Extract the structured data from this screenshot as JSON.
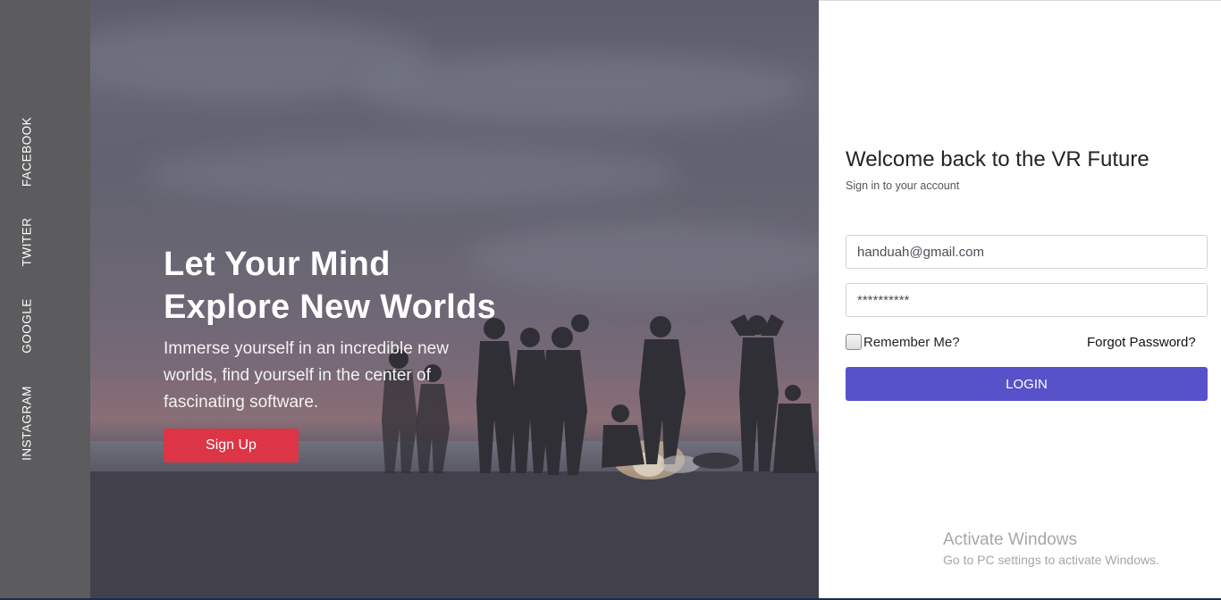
{
  "social": {
    "facebook": "FACEBOOK",
    "twitter": "TWITER",
    "google": "GOOGLE",
    "instagram": "INSTAGRAM"
  },
  "hero": {
    "title_line1": "Let Your Mind",
    "title_line2": "Explore New Worlds",
    "subtitle_line1": "Immerse yourself in an incredible new",
    "subtitle_line2": "worlds, find yourself in the center of",
    "subtitle_line3": "fascinating software.",
    "signup_label": "Sign Up",
    "background_image": "people-around-campfire-on-beach"
  },
  "login": {
    "title": "Welcome back to the VR Future",
    "subtitle": "Sign in to your account",
    "email_value": "handuah@gmail.com",
    "password_value": "**********",
    "remember_label": "Remember Me?",
    "remember_checked": false,
    "forgot_label": "Forgot Password?",
    "login_label": "LOGIN"
  },
  "watermark": {
    "line1": "Activate Windows",
    "line2": "Go to PC settings to activate Windows."
  },
  "colors": {
    "rail": "#5c5b5d",
    "signup": "#dc3545",
    "login": "#5752c9"
  }
}
